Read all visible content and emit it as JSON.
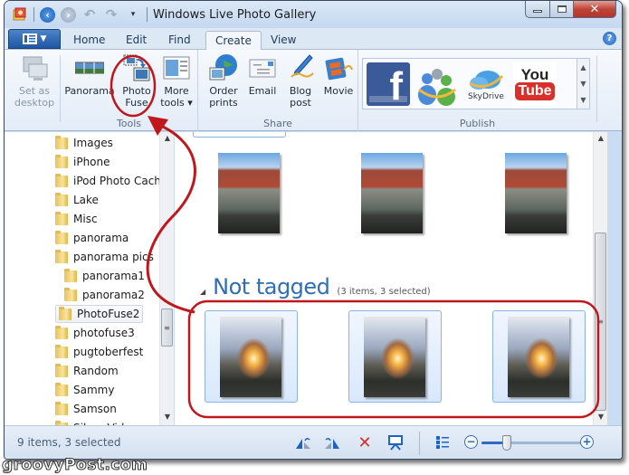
{
  "window": {
    "title": "Windows Live Photo Gallery",
    "controls": {
      "minimize": "—",
      "maximize": "☐",
      "close": "✕"
    }
  },
  "quick_access": {
    "items": [
      "app-icon",
      "back-icon",
      "forward-icon",
      "undo-icon",
      "redo-icon",
      "customize-dropdown-icon"
    ]
  },
  "tabs": [
    {
      "label": "Home",
      "active": false
    },
    {
      "label": "Edit",
      "active": false
    },
    {
      "label": "Find",
      "active": false
    },
    {
      "label": "Create",
      "active": true
    },
    {
      "label": "View",
      "active": false
    }
  ],
  "help_label": "?",
  "ribbon": {
    "groups": [
      {
        "label": "Tools"
      },
      {
        "label": "Share"
      },
      {
        "label": "Publish"
      }
    ],
    "buttons": {
      "set_desktop": "Set as\ndesktop",
      "panorama": "Panorama",
      "photo_fuse": "Photo\nFuse",
      "more_tools": "More\ntools ▾",
      "order_prints": "Order\nprints",
      "email": "Email",
      "blog_post": "Blog\npost",
      "movie": "Movie"
    },
    "publish_gallery": [
      {
        "name": "Facebook",
        "label": "f"
      },
      {
        "name": "Windows Live Groups",
        "label": ""
      },
      {
        "name": "SkyDrive",
        "label": "SkyDrive"
      },
      {
        "name": "YouTube",
        "label_top": "You",
        "label_bottom": "Tube"
      }
    ]
  },
  "folder_tree": {
    "items": [
      {
        "label": "Images",
        "level": 0
      },
      {
        "label": "iPhone",
        "level": 0
      },
      {
        "label": "iPod Photo Cache",
        "level": 0
      },
      {
        "label": "Lake",
        "level": 0
      },
      {
        "label": "Misc",
        "level": 0
      },
      {
        "label": "panorama",
        "level": 0
      },
      {
        "label": "panorama pics",
        "level": 0
      },
      {
        "label": "panorama1",
        "level": 1
      },
      {
        "label": "panorama2",
        "level": 1
      },
      {
        "label": "PhotoFuse2",
        "level": 0,
        "selected": true
      },
      {
        "label": "photofuse3",
        "level": 0
      },
      {
        "label": "pugtoberfest",
        "level": 0
      },
      {
        "label": "Random",
        "level": 0
      },
      {
        "label": "Sammy",
        "level": 0
      },
      {
        "label": "Samson",
        "level": 0
      },
      {
        "label": "Silver Videos",
        "level": 0
      }
    ]
  },
  "main": {
    "group": {
      "name": "Not tagged",
      "count": "(3 items, 3 selected)"
    },
    "top_photos": [
      {
        "subject": "street-building"
      },
      {
        "subject": "street-building"
      },
      {
        "subject": "street-building"
      }
    ],
    "selected_photos": [
      {
        "subject": "fireplace-dog",
        "selected": true
      },
      {
        "subject": "fireplace-dog",
        "selected": true
      },
      {
        "subject": "fireplace-dog",
        "selected": true
      }
    ]
  },
  "status_bar": {
    "text": "9 items, 3 selected",
    "zoom_level_fraction": 0.25,
    "buttons": [
      "rotate-left",
      "rotate-right",
      "delete",
      "slideshow",
      "details-view",
      "zoom-out",
      "zoom-in"
    ]
  },
  "watermark": "groovyPost.com",
  "colors": {
    "accent": "#2e6fb7",
    "annotation": "#c0171c",
    "selection": "#8db2e3"
  }
}
